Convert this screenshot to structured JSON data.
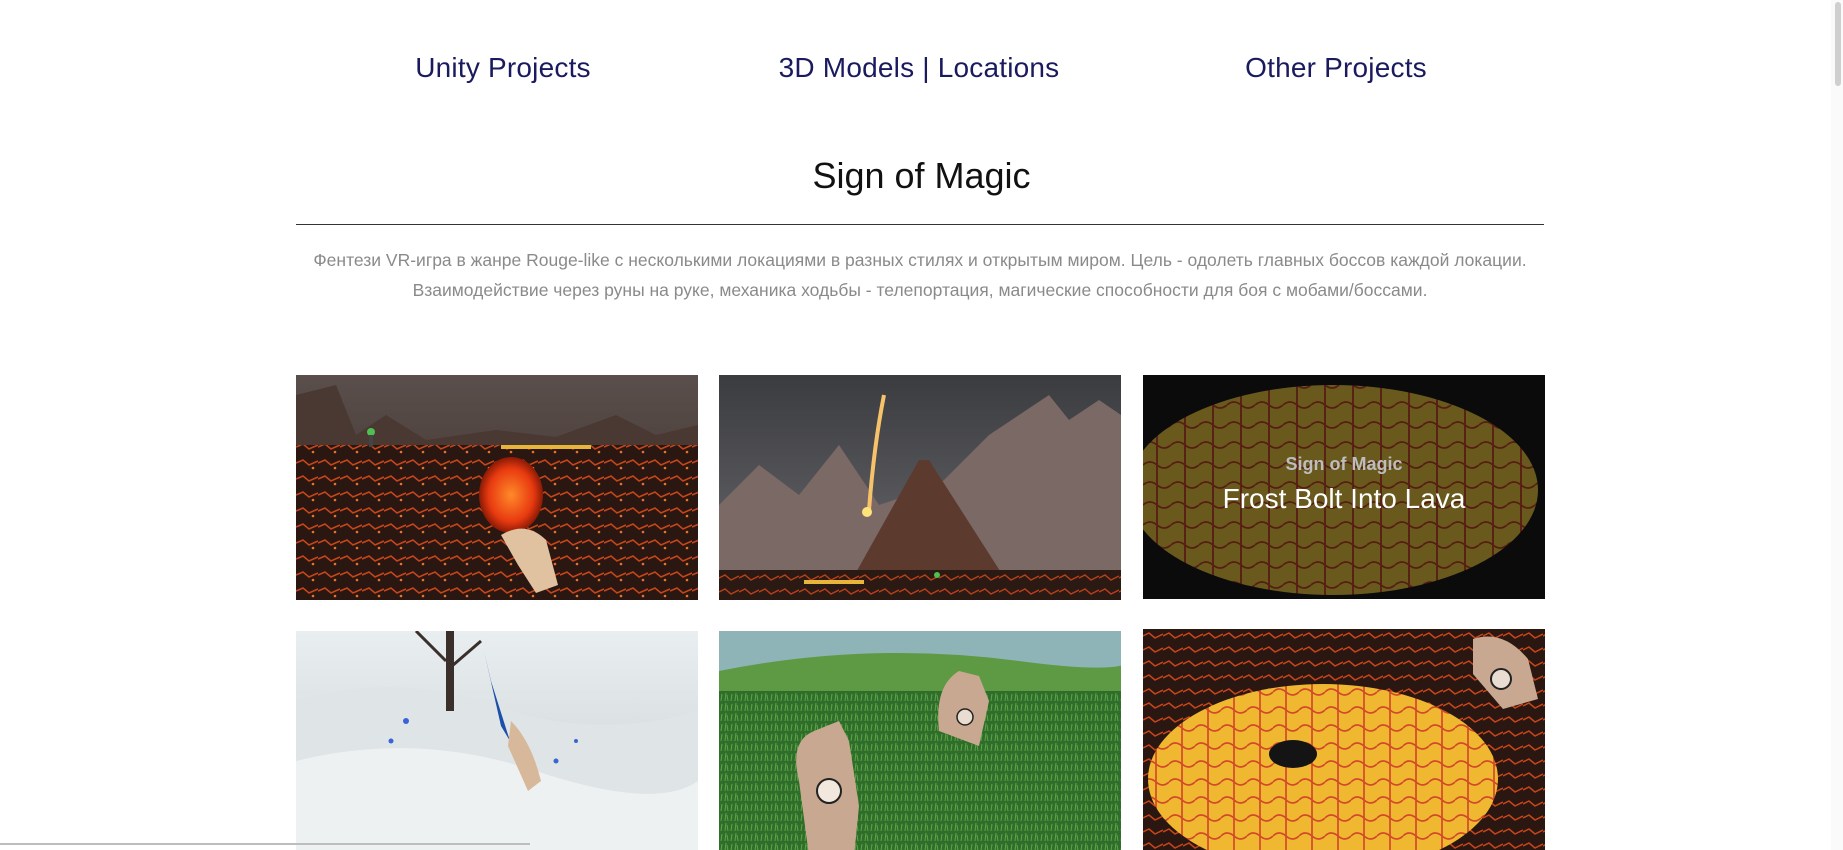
{
  "nav": {
    "items": [
      {
        "label": "Unity Projects"
      },
      {
        "label": "3D Models | Locations"
      },
      {
        "label": "Other Projects"
      }
    ]
  },
  "project": {
    "title": "Sign of Magic",
    "description_line1": "Фентези VR-игра в жанре Rouge-like с несколькими локациями в разных стилях и открытым миром. Цель - одолеть главных боссов каждой локации.",
    "description_line2": "Взаимодействие через руны на руке, механика ходьбы - телепортация, магические способности для боя с мобами/боссами."
  },
  "gallery": {
    "hover_tile": {
      "subtitle": "Sign of Magic",
      "caption": "Frost Bolt Into Lava"
    }
  },
  "colors": {
    "nav_link": "#1a1a5e",
    "description": "#8a8a8a",
    "title": "#111111"
  }
}
